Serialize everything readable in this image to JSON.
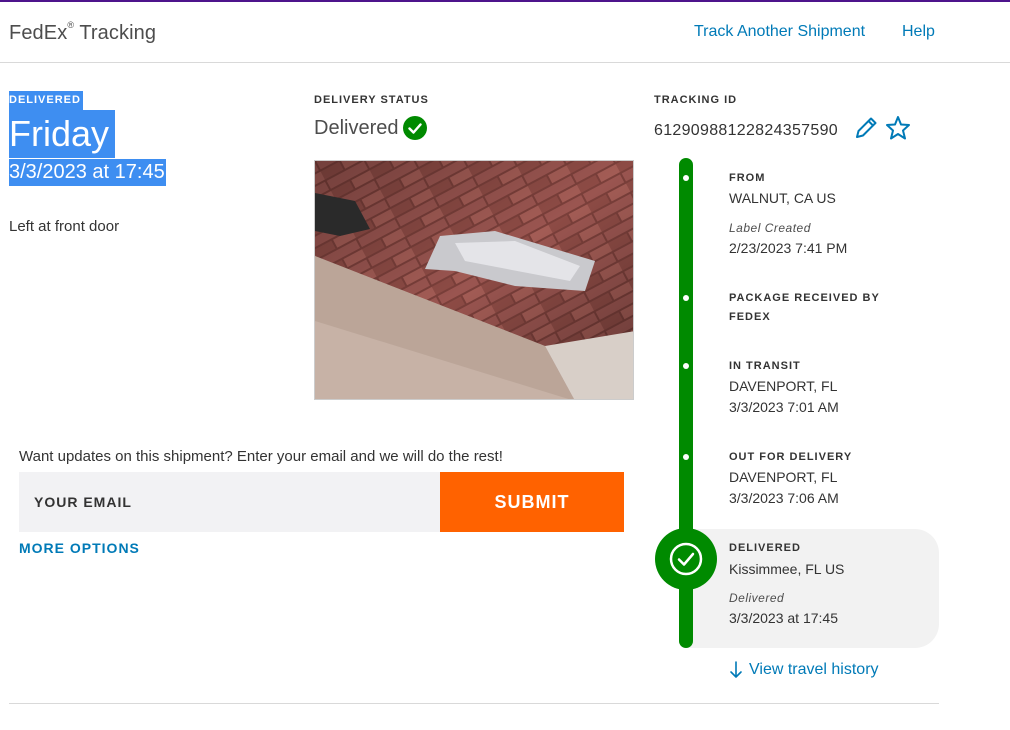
{
  "header": {
    "brand": "FedEx",
    "brand_mark": "®",
    "brand_suffix": " Tracking",
    "nav": {
      "track_another": "Track Another Shipment",
      "help": "Help"
    }
  },
  "summary": {
    "status_label": "DELIVERED",
    "day": "Friday",
    "datetime": "3/3/2023 at 17:45",
    "note": "Left at front door"
  },
  "delivery_status": {
    "title": "DELIVERY STATUS",
    "value": "Delivered"
  },
  "tracking": {
    "title": "TRACKING ID",
    "id": "612909881228243575​90"
  },
  "timeline": [
    {
      "title": "FROM",
      "line1": "WALNUT, CA US",
      "italic": "Label Created",
      "line2": "2/23/2023 7:41 PM"
    },
    {
      "title": "PACKAGE RECEIVED BY FEDEX"
    },
    {
      "title": "IN TRANSIT",
      "line1": "DAVENPORT, FL",
      "line2": "3/3/2023 7:01 AM"
    },
    {
      "title": "OUT FOR DELIVERY",
      "line1": "DAVENPORT, FL",
      "line2": "3/3/2023 7:06 AM"
    },
    {
      "title": "DELIVERED",
      "line1": "Kissimmee, FL US",
      "italic": "Delivered",
      "line2": "3/3/2023 at 17:45"
    }
  ],
  "view_history": "View travel history",
  "email": {
    "prompt": "Want updates on this shipment? Enter your email and we will do the rest!",
    "placeholder": "YOUR EMAIL",
    "submit": "SUBMIT",
    "more_options": "MORE OPTIONS"
  },
  "colors": {
    "brand_purple": "#4d148c",
    "link_blue": "#007ab7",
    "status_green": "#008a00",
    "submit_orange": "#ff6200"
  }
}
